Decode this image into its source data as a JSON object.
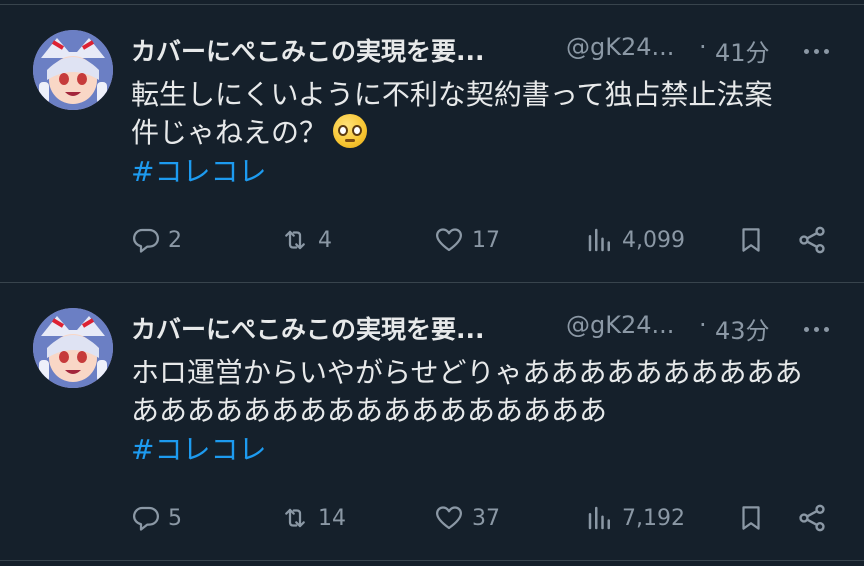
{
  "tweets": [
    {
      "author_name": "カバーにぺこみこの実現を要...",
      "handle": "@gK24...",
      "separator": "·",
      "time": "41分",
      "text_lines": [
        "転生しにくいように不利な契約書って独占禁止法案",
        "件じゃねえの？"
      ],
      "emoji": "pleading-face",
      "hashtag": "#コレコレ",
      "replies": "2",
      "retweets": "4",
      "likes": "17",
      "views": "4,099"
    },
    {
      "author_name": "カバーにぺこみこの実現を要...",
      "handle": "@gK24...",
      "separator": "·",
      "time": "43分",
      "text_lines": [
        "ホロ運営からいやがらせどりゃああああああああああ",
        "あああああああああああああああああ"
      ],
      "hashtag": "#コレコレ",
      "replies": "5",
      "retweets": "14",
      "likes": "37",
      "views": "7,192"
    }
  ],
  "colors": {
    "background": "#15202b",
    "divider": "#38444d",
    "text": "#e7e9ea",
    "muted": "#8b98a5",
    "link": "#1d9bf0"
  },
  "icons": [
    "reply-icon",
    "retweet-icon",
    "like-icon",
    "views-icon",
    "bookmark-icon",
    "share-icon",
    "more-icon"
  ]
}
